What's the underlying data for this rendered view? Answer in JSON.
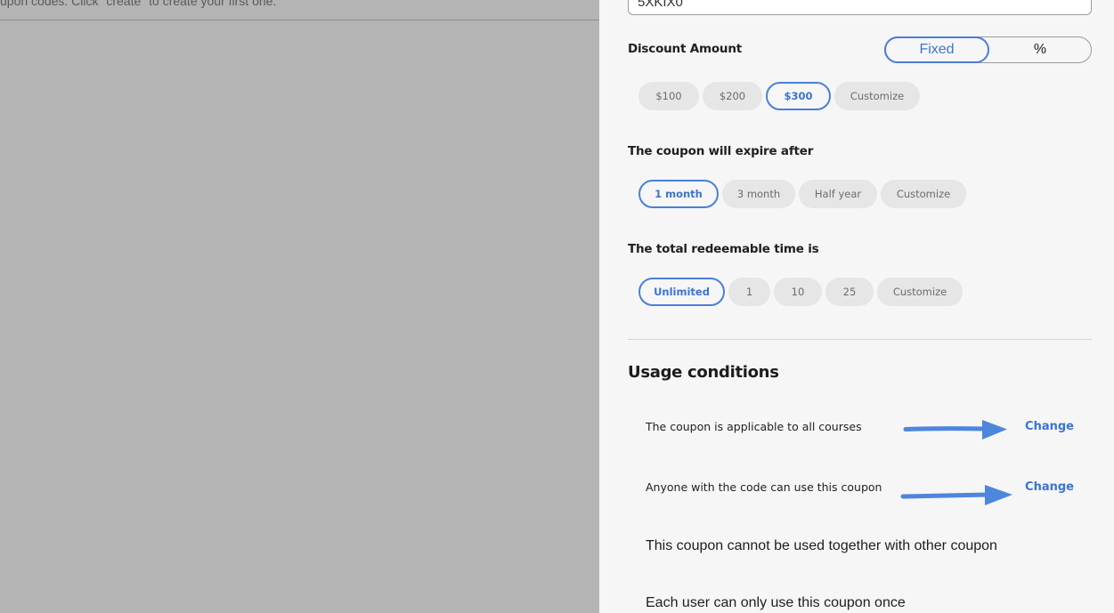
{
  "backdrop": {
    "hint_text": "upon codes. Click \"create\" to create your first one."
  },
  "drawer": {
    "coupon_code": "5XKIX0",
    "discount_amount": {
      "label": "Discount Amount",
      "modes": [
        "Fixed",
        "%"
      ],
      "selected_mode": "Fixed",
      "options": [
        "$100",
        "$200",
        "$300",
        "Customize"
      ],
      "selected": "$300"
    },
    "expiry": {
      "label": "The coupon will expire after",
      "options": [
        "1 month",
        "3 month",
        "Half year",
        "Customize"
      ],
      "selected": "1 month"
    },
    "redeemable": {
      "label": "The total redeemable time is",
      "options": [
        "Unlimited",
        "1",
        "10",
        "25",
        "Customize"
      ],
      "selected": "Unlimited"
    },
    "usage": {
      "title": "Usage conditions",
      "conditions": [
        {
          "text": "The coupon is applicable to all courses",
          "action": "Change"
        },
        {
          "text": "Anyone with the code can use this coupon",
          "action": "Change"
        },
        {
          "text": "This coupon cannot be used together with other coupon"
        },
        {
          "text": "Each user can only use this coupon once"
        }
      ]
    }
  },
  "colors": {
    "accent": "#3b74d2",
    "arrow": "#4d86dc",
    "panel_bg": "#f6f6f6",
    "backdrop": "#b4b4b4"
  },
  "icons": [
    "right-arrow-icon"
  ]
}
